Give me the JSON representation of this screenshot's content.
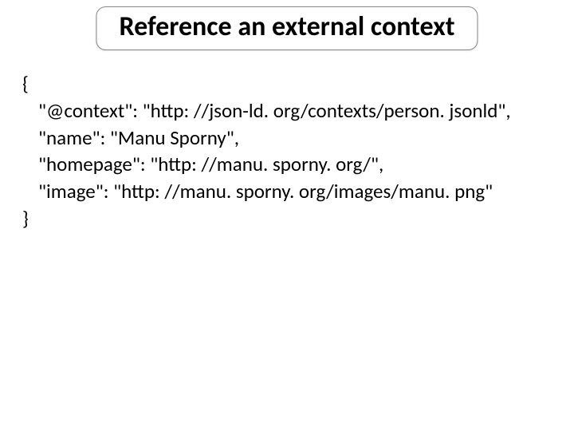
{
  "title": "Reference an external context",
  "code": {
    "open": "{",
    "line1": "\"@context\": \"http: //json-ld. org/contexts/person. jsonld\",",
    "line2": "\"name\": \"Manu Sporny\",",
    "line3": "\"homepage\": \"http: //manu. sporny. org/\",",
    "line4": "\"image\": \"http: //manu. sporny. org/images/manu. png\"",
    "close": "}"
  }
}
